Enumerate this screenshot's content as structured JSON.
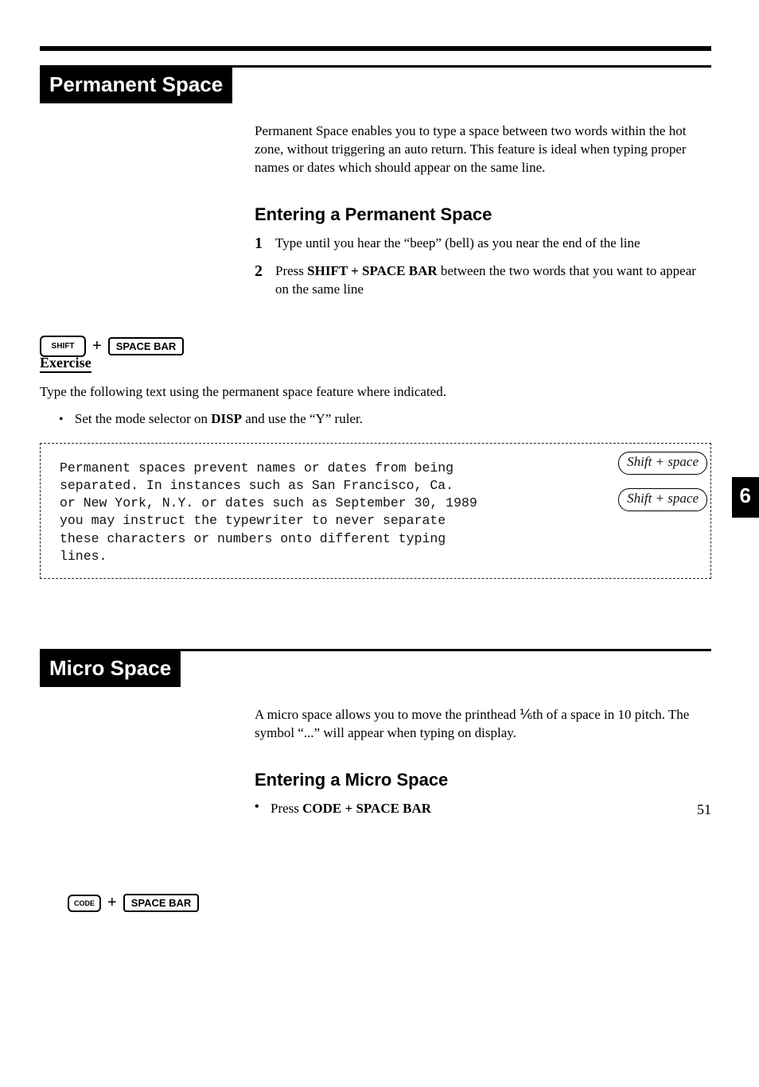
{
  "page_number": "51",
  "chapter_tab": "6",
  "section1": {
    "title": "Permanent Space",
    "intro": "Permanent Space enables you to type a space between two words within the hot zone, without triggering an auto return. This feature is ideal when typing proper names or dates which should appear on the same line.",
    "sub": "Entering a Permanent Space",
    "step1_num": "1",
    "step1": "Type until you hear the “beep” (bell) as you near the end of the line",
    "step2_num": "2",
    "step2_pre": "Press ",
    "step2_b": "SHIFT + SPACE BAR",
    "step2_post": " between the two words that you want to appear on the same line",
    "key_shift": "SHIFT",
    "key_plus": "+",
    "key_space": "SPACE BAR"
  },
  "exercise": {
    "heading": "Exercise",
    "line1": "Type the following text using the permanent space feature where indicated.",
    "bullet_pre": "Set the mode selector on ",
    "bullet_b": "DISP",
    "bullet_post": " and use the “Y” ruler.",
    "box_l1": "Permanent spaces prevent names or dates from being",
    "box_l2": "separated.  In instances such as San Francisco, Ca.",
    "box_l3": "or New York, N.Y. or dates such as September 30, 1989",
    "box_l4": "you may instruct the typewriter to never separate",
    "box_l5": "these characters or numbers onto different typing",
    "box_l6": "lines.",
    "note1": "Shift + space",
    "note2": "Shift + space"
  },
  "section2": {
    "title": "Micro Space",
    "intro": "A micro space allows you to move the printhead ⅙th of a space in 10 pitch. The symbol “...” will appear when typing on display.",
    "sub": "Entering a Micro Space",
    "bullet_pre": "Press ",
    "bullet_b": "CODE + SPACE BAR",
    "key_code": "CODE",
    "key_plus": "+",
    "key_space": "SPACE BAR"
  }
}
